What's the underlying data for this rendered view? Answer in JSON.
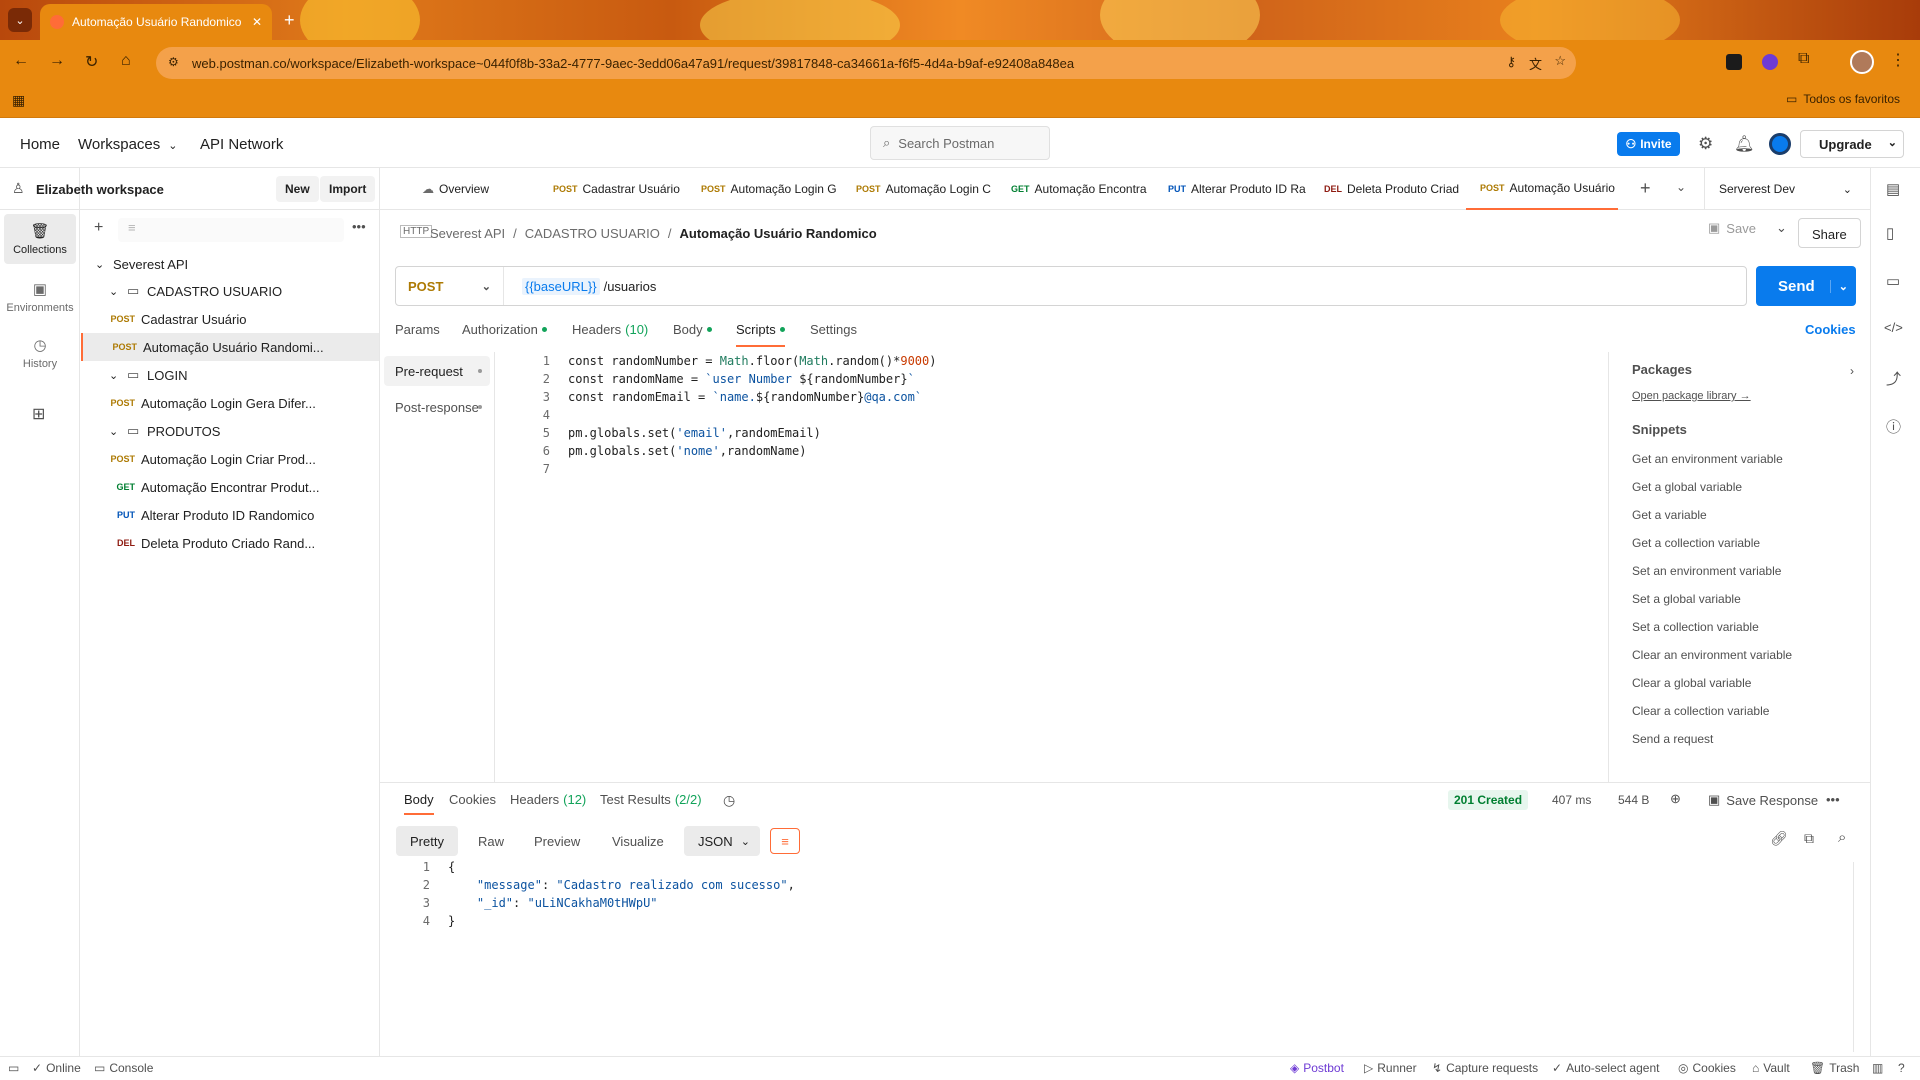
{
  "browser": {
    "tab_title": "Automação Usuário Randomico",
    "url": "web.postman.co/workspace/Elizabeth-workspace~044f0f8b-33a2-4777-9aec-3edd06a47a91/request/39817848-ca34661a-f6f5-4d4a-b9af-e92408a848ea",
    "bookmarks_label": "Todos os favoritos"
  },
  "header": {
    "home": "Home",
    "workspaces": "Workspaces",
    "api_network": "API Network",
    "search_placeholder": "Search Postman",
    "invite": "Invite",
    "upgrade": "Upgrade"
  },
  "rail": {
    "collections": "Collections",
    "environments": "Environments",
    "history": "History"
  },
  "sidebar": {
    "workspace_name": "Elizabeth workspace",
    "new_btn": "New",
    "import_btn": "Import",
    "collection": "Severest API",
    "folders": [
      {
        "name": "CADASTRO USUARIO",
        "items": [
          {
            "method": "POST",
            "name": "Cadastrar Usuário"
          },
          {
            "method": "POST",
            "name": "Automação Usuário Randomi..."
          }
        ]
      },
      {
        "name": "LOGIN",
        "items": [
          {
            "method": "POST",
            "name": "Automação Login Gera Difer..."
          }
        ]
      },
      {
        "name": "PRODUTOS",
        "items": [
          {
            "method": "POST",
            "name": "Automação Login Criar Prod..."
          },
          {
            "method": "GET",
            "name": "Automação Encontrar Produt..."
          },
          {
            "method": "PUT",
            "name": "Alterar Produto ID Randomico"
          },
          {
            "method": "DEL",
            "name": "Deleta Produto Criado Rand..."
          }
        ]
      }
    ]
  },
  "tabs": [
    {
      "method": "",
      "label": "Overview"
    },
    {
      "method": "POST",
      "label": "Cadastrar Usuário"
    },
    {
      "method": "POST",
      "label": "Automação Login G"
    },
    {
      "method": "POST",
      "label": "Automação Login C"
    },
    {
      "method": "GET",
      "label": "Automação Encontra"
    },
    {
      "method": "PUT",
      "label": "Alterar Produto ID Ra"
    },
    {
      "method": "DEL",
      "label": "Deleta Produto Criad"
    },
    {
      "method": "POST",
      "label": "Automação Usuário"
    }
  ],
  "environment": "Serverest Dev",
  "breadcrumb": {
    "collection": "Severest API",
    "folder": "CADASTRO USUARIO",
    "current": "Automação Usuário Randomico"
  },
  "actions": {
    "save": "Save",
    "share": "Share"
  },
  "request": {
    "method": "POST",
    "url_var": "{{baseURL}}",
    "url_path": "/usuarios",
    "send": "Send"
  },
  "request_tabs": {
    "params": "Params",
    "authorization": "Authorization",
    "headers": "Headers",
    "headers_count": "(10)",
    "body": "Body",
    "scripts": "Scripts",
    "settings": "Settings",
    "cookies": "Cookies"
  },
  "script_tabs": {
    "pre": "Pre-request",
    "post": "Post-response"
  },
  "script_lines": [
    {
      "n": "1",
      "parts": [
        [
          "kw",
          "const randomNumber = "
        ],
        [
          "fn",
          "Math"
        ],
        [
          "kw",
          ".floor("
        ],
        [
          "fn",
          "Math"
        ],
        [
          "kw",
          ".random()*"
        ],
        [
          "num",
          "9000"
        ],
        [
          "kw",
          ")"
        ]
      ]
    },
    {
      "n": "2",
      "parts": [
        [
          "kw",
          "const randomName = "
        ],
        [
          "str",
          "`user Number "
        ],
        [
          "kw",
          "${randomNumber}"
        ],
        [
          "str",
          "`"
        ]
      ]
    },
    {
      "n": "3",
      "parts": [
        [
          "kw",
          "const randomEmail = "
        ],
        [
          "str",
          "`name."
        ],
        [
          "kw",
          "${randomNumber}"
        ],
        [
          "str",
          "@qa.com`"
        ]
      ]
    },
    {
      "n": "4",
      "parts": []
    },
    {
      "n": "5",
      "parts": [
        [
          "kw",
          "pm.globals.set("
        ],
        [
          "str",
          "'email'"
        ],
        [
          "kw",
          ",randomEmail)"
        ]
      ]
    },
    {
      "n": "6",
      "parts": [
        [
          "kw",
          "pm.globals.set("
        ],
        [
          "str",
          "'nome'"
        ],
        [
          "kw",
          ",randomName)"
        ]
      ]
    },
    {
      "n": "7",
      "parts": []
    }
  ],
  "packages": {
    "title": "Packages",
    "link": "Open package library →"
  },
  "snippets": {
    "title": "Snippets",
    "items": [
      "Get an environment variable",
      "Get a global variable",
      "Get a variable",
      "Get a collection variable",
      "Set an environment variable",
      "Set a global variable",
      "Set a collection variable",
      "Clear an environment variable",
      "Clear a global variable",
      "Clear a collection variable",
      "Send a request"
    ]
  },
  "response": {
    "tabs": {
      "body": "Body",
      "cookies": "Cookies",
      "headers": "Headers",
      "headers_count": "(12)",
      "tests": "Test Results",
      "tests_count": "(2/2)"
    },
    "status": "201 Created",
    "time": "407 ms",
    "size": "544 B",
    "save_response": "Save Response",
    "formats": {
      "pretty": "Pretty",
      "raw": "Raw",
      "preview": "Preview",
      "visualize": "Visualize",
      "json": "JSON"
    },
    "lines": [
      {
        "n": "1",
        "parts": [
          [
            "kw",
            "{"
          ]
        ]
      },
      {
        "n": "2",
        "parts": [
          [
            "kw",
            "    "
          ],
          [
            "str",
            "\"message\""
          ],
          [
            "kw",
            ": "
          ],
          [
            "str",
            "\"Cadastro realizado com sucesso\""
          ],
          [
            "kw",
            ","
          ]
        ]
      },
      {
        "n": "3",
        "parts": [
          [
            "kw",
            "    "
          ],
          [
            "str",
            "\"_id\""
          ],
          [
            "kw",
            ": "
          ],
          [
            "str",
            "\"uLiNCakhaM0tHWpU\""
          ]
        ]
      },
      {
        "n": "4",
        "parts": [
          [
            "kw",
            "}"
          ]
        ]
      }
    ]
  },
  "statusbar": {
    "online": "Online",
    "console": "Console",
    "postbot": "Postbot",
    "runner": "Runner",
    "capture": "Capture requests",
    "agent": "Auto-select agent",
    "cookies": "Cookies",
    "vault": "Vault",
    "trash": "Trash"
  },
  "colors": {
    "accent": "#097bed",
    "postman_orange": "#ff6c37",
    "browser_frame": "#e8890f"
  }
}
